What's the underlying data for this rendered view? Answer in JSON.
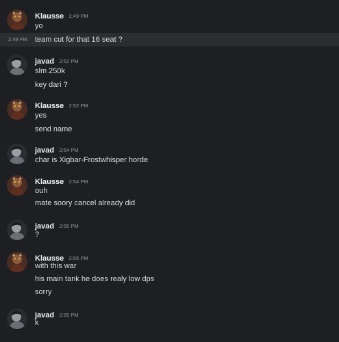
{
  "users": {
    "klausse": {
      "name": "Klausse"
    },
    "javad": {
      "name": "javad"
    }
  },
  "messages": [
    {
      "author": "Klausse",
      "time": "2:49 PM",
      "lines": [
        "yo",
        "team cut for that 16 seat ?"
      ],
      "hover_time": "2:49 PM"
    },
    {
      "author": "javad",
      "time": "2:52 PM",
      "lines": [
        "slm 250k",
        "key dari ?"
      ]
    },
    {
      "author": "Klausse",
      "time": "2:52 PM",
      "lines": [
        "yes",
        "send name"
      ]
    },
    {
      "author": "javad",
      "time": "2:54 PM",
      "lines": [
        "char is Xigbar-Frostwhisper horde"
      ]
    },
    {
      "author": "Klausse",
      "time": "2:54 PM",
      "lines": [
        "ouh",
        "mate soory cancel already did"
      ]
    },
    {
      "author": "javad",
      "time": "2:55 PM",
      "lines": [
        "?"
      ]
    },
    {
      "author": "Klausse",
      "time": "2:55 PM",
      "lines": [
        "with this war",
        "his main tank he does realy low dps",
        "sorry"
      ]
    },
    {
      "author": "javad",
      "time": "2:55 PM",
      "lines": [
        "k"
      ]
    }
  ]
}
